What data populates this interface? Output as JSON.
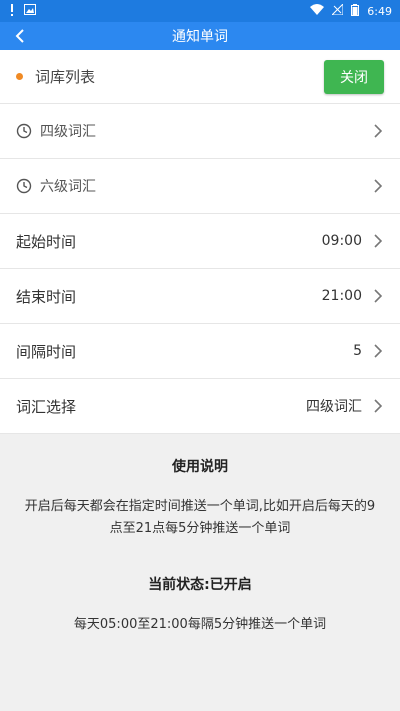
{
  "statusbar": {
    "time": "6:49"
  },
  "appbar": {
    "title": "通知单词"
  },
  "lexicon": {
    "title": "词库列表",
    "close_label": "关闭",
    "items": [
      {
        "label": "四级词汇"
      },
      {
        "label": "六级词汇"
      }
    ]
  },
  "settings": {
    "start": {
      "label": "起始时间",
      "value": "09:00"
    },
    "end": {
      "label": "结束时间",
      "value": "21:00"
    },
    "interval": {
      "label": "间隔时间",
      "value": "5"
    },
    "vocab": {
      "label": "词汇选择",
      "value": "四级词汇"
    }
  },
  "info": {
    "usage_title": "使用说明",
    "usage_text": "开启后每天都会在指定时间推送一个单词,比如开启后每天的9点至21点每5分钟推送一个单词",
    "status_title": "当前状态:已开启",
    "status_text": "每天05:00至21:00每隔5分钟推送一个单词"
  },
  "colors": {
    "primary": "#2c88f0",
    "status_bar": "#1e7be0",
    "accent_green": "#3fb651",
    "dot_orange": "#f08a24"
  }
}
